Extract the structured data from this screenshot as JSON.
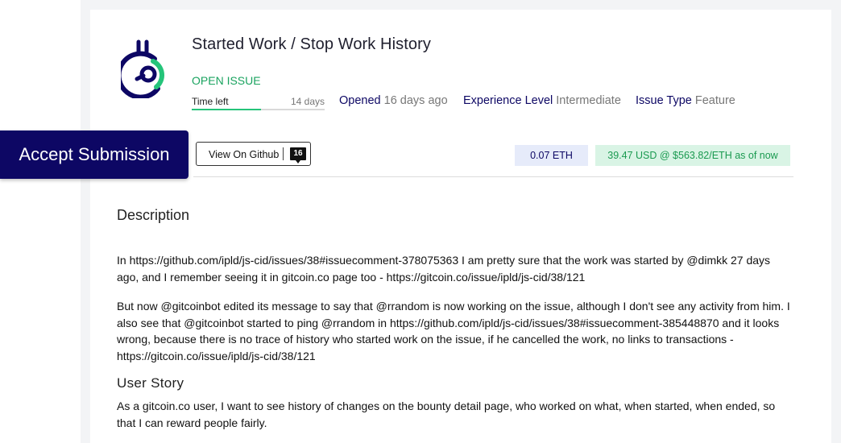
{
  "issue": {
    "title": "Started Work / Stop Work History",
    "status": "OPEN ISSUE",
    "time_left_label": "Time left",
    "time_left_value": "14 days",
    "time_progress_fraction": 0.52,
    "opened_key": "Opened",
    "opened_value": "16 days ago",
    "experience_key": "Experience Level",
    "experience_value": "Intermediate",
    "issue_type_key": "Issue Type",
    "issue_type_value": "Feature"
  },
  "actions": {
    "accept_label": "Accept Submission",
    "github_label": "View On Github",
    "github_count": "16"
  },
  "amounts": {
    "eth": "0.07 ETH",
    "usd": "39.47  USD @  $563.82/ETH  as of now"
  },
  "description": {
    "heading": "Description",
    "paragraphs": [
      "In https://github.com/ipld/js-cid/issues/38#issuecomment-378075363 I am pretty sure that the work was started by @dimkk 27 days ago, and I remember seeing it in gitcoin.co page too - https://gitcoin.co/issue/ipld/js-cid/38/121",
      "But now @gitcoinbot edited its message to say that @rrandom is now working on the issue, although I don't see any activity from him. I also see that @gitcoinbot started to ping @rrandom in https://github.com/ipld/js-cid/issues/38#issuecomment-385448870 and it looks wrong, because there is no trace of history who started work on the issue, if he cancelled the work, no links to transactions - https://gitcoin.co/issue/ipld/js-cid/38/121"
    ],
    "user_story_heading": "User Story",
    "user_story": "As a gitcoin.co user, I want to see history of changes on the bounty detail page, who worked on what, when started, when ended, so that I can reward people fairly."
  },
  "colors": {
    "brand_navy": "#0d0764",
    "open_green": "#1aa35f",
    "progress_green": "#25c47a",
    "eth_bg": "#e6ebfa",
    "usd_bg": "#d9f4e5"
  },
  "icons": {
    "logo": "gitcoin-logo-icon",
    "github_badge": "comment-count-icon"
  }
}
